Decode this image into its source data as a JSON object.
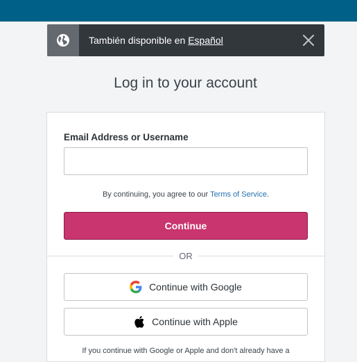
{
  "banner": {
    "text": "También disponible en ",
    "link": "Español",
    "icon": "globe-icon",
    "close_icon": "close-icon"
  },
  "page": {
    "heading": "Log in to your account"
  },
  "form": {
    "email_label": "Email Address or Username",
    "email_value": "",
    "tos_prefix": "By continuing, you agree to our ",
    "tos_link": "Terms of Service",
    "tos_suffix": ".",
    "continue_label": "Continue",
    "or_label": "OR",
    "google_label": "Continue with Google",
    "apple_label": "Continue with Apple",
    "footnote": "If you continue with Google or Apple and don't already have a"
  },
  "colors": {
    "top_bar": "#016087",
    "primary_button": "#c9356e",
    "banner": "#32373c",
    "link": "#2271b1"
  }
}
